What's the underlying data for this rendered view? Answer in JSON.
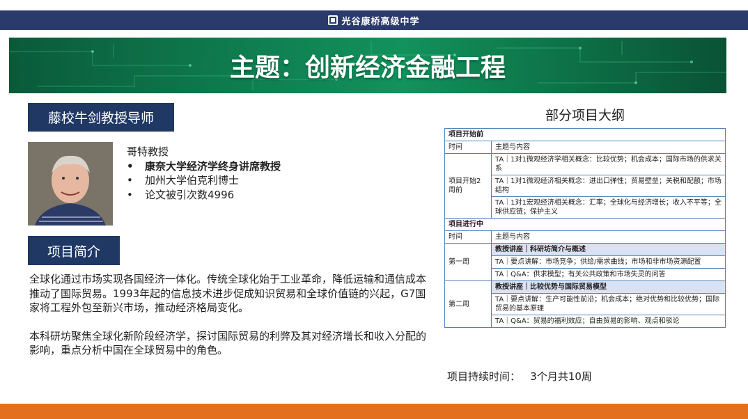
{
  "header": {
    "school_name": "光谷康桥高级中学"
  },
  "banner": {
    "title": "主题：创新经济金融工程"
  },
  "mentor": {
    "label": "藤校牛剑教授导师",
    "name": "哥特教授",
    "credentials": [
      {
        "text": "康奈大学经济学终身讲席教授",
        "bold": true
      },
      {
        "text": "加州大学伯克利博士",
        "bold": false
      },
      {
        "text": "论文被引次数4996",
        "bold": false
      }
    ]
  },
  "intro": {
    "label": "项目简介",
    "paragraphs": [
      "全球化通过市场实现各国经济一体化。传统全球化始于工业革命，降低运输和通信成本推动了国际贸易。1993年起的信息技术进步促成知识贸易和全球价值链的兴起，G7国家将工程外包至新兴市场，推动经济格局变化。",
      "本科研坊聚焦全球化新阶段经济学，探讨国际贸易的利弊及其对经济增长和收入分配的影响，重点分析中国在全球贸易中的角色。"
    ]
  },
  "outline": {
    "title": "部分项目大纲",
    "before": {
      "section": "项目开始前",
      "head_time": "时间",
      "head_content": "主题与内容",
      "period": "项目开始2周前",
      "rows": [
        "TA｜1对1微观经济学相关概念：比较优势；机会成本；国际市场的供求关系",
        "TA｜1对1微观经济相关概念：进出口弹性；贸易壁垒；关税和配额；市场结构",
        "TA｜1对1宏观经济相关概念：汇率；全球化与经济增长；收入不平等；全球供应链；保护主义"
      ]
    },
    "during": {
      "section": "项目进行中",
      "head_time": "时间",
      "head_content": "主题与内容",
      "weeks": [
        {
          "label": "第一周",
          "lecture": "教授讲座｜科研坊简介与概述",
          "items": [
            "TA｜要点讲解：市场竞争；供给/需求曲线；市场和非市场资源配置",
            "TA｜Q&A：供求模型；有关公共政策和市场失灵的问答"
          ]
        },
        {
          "label": "第二周",
          "lecture": "教授讲座｜比较优势与国际贸易模型",
          "items": [
            "TA｜要点讲解：生产可能性前沿；机会成本；绝对优势和比较优势；国际贸易的基本原理",
            "TA｜Q&A：贸易的福利效应；自由贸易的影响、观点和驳论"
          ]
        }
      ]
    },
    "duration": "项目持续时间：   3个月共10周"
  },
  "colors": {
    "navy": "#2a3a6b",
    "label_blue": "#1f3864",
    "banner_green": "#0f7a4e",
    "table_border": "#4f81bd",
    "highlight": "#d9e2f3",
    "accent_orange": "#e2701e"
  }
}
